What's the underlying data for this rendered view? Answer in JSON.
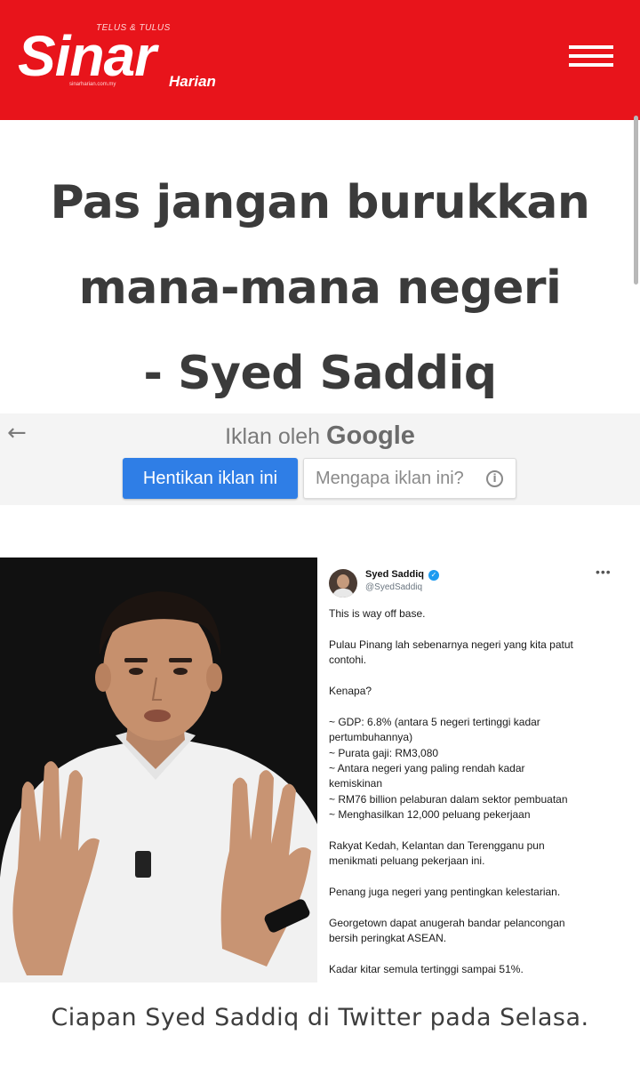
{
  "header": {
    "logo": {
      "name": "Sinar",
      "sub": "Harian",
      "tagline": "TELUS & TULUS",
      "url": "sinarharian.com.my"
    },
    "brand_color": "#e8141b",
    "menu_icon": "hamburger-menu-icon"
  },
  "article": {
    "headline_lines": [
      "Pas jangan burukkan",
      "mana-mana negeri",
      "- Syed Saddiq"
    ],
    "caption": "Ciapan Syed Saddiq di Twitter pada Selasa."
  },
  "ad": {
    "title_prefix": "Iklan oleh",
    "title_brand": "Google",
    "stop_label": "Hentikan iklan ini",
    "why_label": "Mengapa iklan ini?",
    "back_icon": "back-arrow-icon",
    "info_icon": "info-icon",
    "accent": "#2f7ee6"
  },
  "tweet": {
    "name": "Syed Saddiq",
    "handle": "@SyedSaddiq",
    "verified_icon": "verified-badge-icon",
    "more_icon": "more-options-icon",
    "lines": [
      "This is way off base.",
      "",
      "Pulau Pinang lah sebenarnya negeri yang kita patut",
      "contohi.",
      "",
      "Kenapa?",
      "",
      "~ GDP: 6.8% (antara 5 negeri tertinggi kadar",
      "pertumbuhannya)",
      "~ Purata gaji: RM3,080",
      "~ Antara negeri yang paling rendah kadar",
      "kemiskinan",
      "~ RM76 billion pelaburan dalam sektor pembuatan",
      "~ Menghasilkan 12,000 peluang pekerjaan",
      "",
      "Rakyat Kedah, Kelantan dan Terengganu pun",
      "menikmati peluang pekerjaan ini.",
      "",
      "Penang juga negeri yang pentingkan kelestarian.",
      "",
      "Georgetown dapat anugerah bandar pelancongan",
      "bersih peringkat ASEAN.",
      "",
      "Kadar kitar semula tertinggi sampai 51%."
    ]
  }
}
